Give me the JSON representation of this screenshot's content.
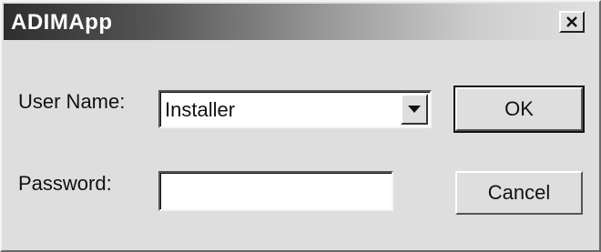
{
  "window": {
    "title": "ADIMApp",
    "close_icon": "close-icon"
  },
  "form": {
    "username_label": "User Name:",
    "username_value": "Installer",
    "password_label": "Password:",
    "password_value": ""
  },
  "buttons": {
    "ok_label": "OK",
    "cancel_label": "Cancel"
  },
  "colors": {
    "dialog_bg": "#dedede",
    "title_gradient_start": "#2e2e2e",
    "title_gradient_end": "#e0e0e0"
  }
}
